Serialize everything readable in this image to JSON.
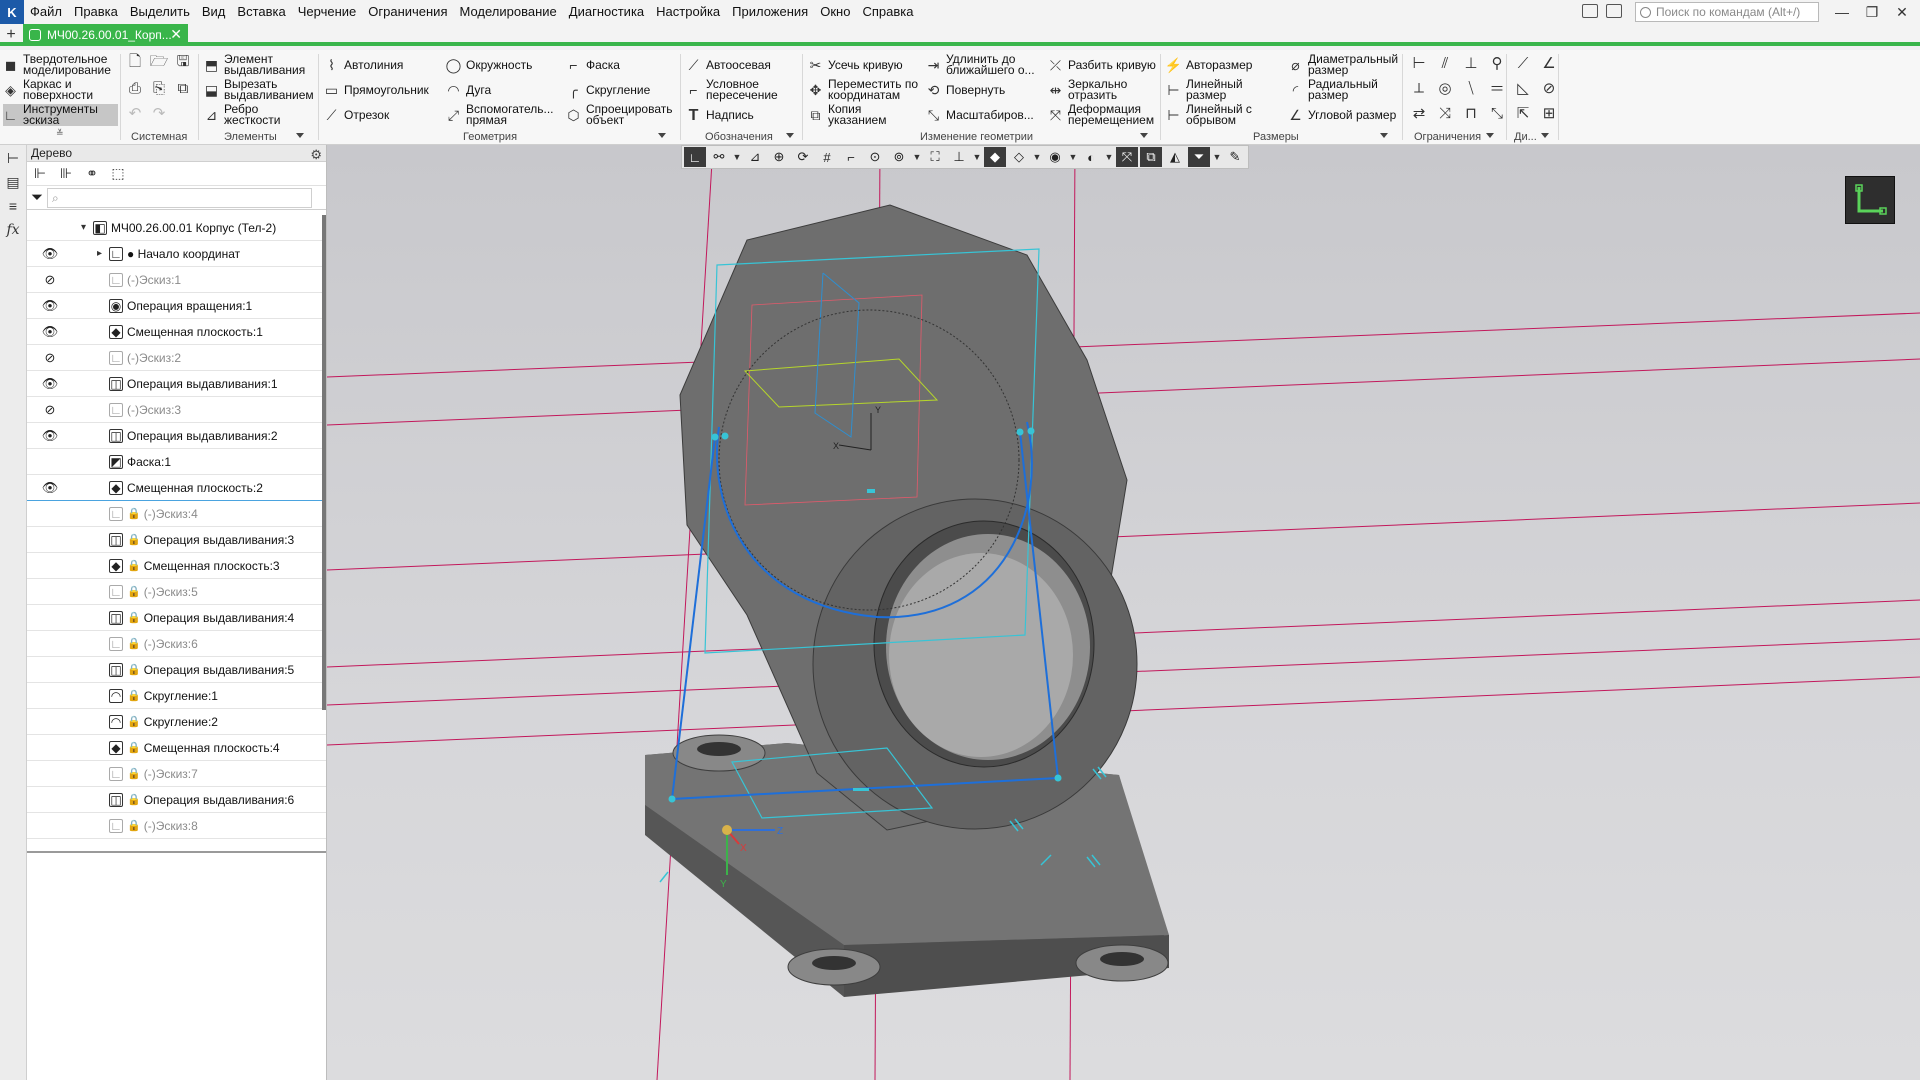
{
  "menubar": {
    "logo": "K",
    "items": [
      "Файл",
      "Правка",
      "Выделить",
      "Вид",
      "Вставка",
      "Черчение",
      "Ограничения",
      "Моделирование",
      "Диагностика",
      "Настройка",
      "Приложения",
      "Окно",
      "Справка"
    ],
    "search_placeholder": "Поиск по командам (Alt+/)"
  },
  "tabs": {
    "plus": "+",
    "doc_label": "МЧ00.26.00.01_Корп...",
    "close": "✕"
  },
  "ribbon": {
    "modes": [
      {
        "label": "Твердотельное\nмоделирование",
        "icon": "solid-icon"
      },
      {
        "label": "Каркас и\nповерхности",
        "icon": "wireframe-icon"
      },
      {
        "label": "Инструменты\nэскиза",
        "icon": "sketch-tools-icon",
        "active": true
      }
    ],
    "groups": {
      "system": "Системная",
      "elements": "Элементы",
      "geometry": "Геометрия",
      "annotations": "Обозначения",
      "modify": "Изменение геометрии",
      "dimensions": "Размеры",
      "constraints": "Ограничения",
      "di": "Ди..."
    },
    "elements": [
      {
        "label": "Элемент\nвыдавливания"
      },
      {
        "label": "Вырезать\nвыдавливанием"
      },
      {
        "label": "Ребро\nжесткости"
      }
    ],
    "geometry": [
      {
        "label": "Автолиния"
      },
      {
        "label": "Прямоугольник"
      },
      {
        "label": "Отрезок"
      },
      {
        "label": "Окружность"
      },
      {
        "label": "Дуга"
      },
      {
        "label": "Вспомогатель...\nпрямая"
      },
      {
        "label": "Фаска"
      },
      {
        "label": "Скругление"
      },
      {
        "label": "Спроецировать\nобъект"
      }
    ],
    "annotations": [
      {
        "label": "Автоосевая"
      },
      {
        "label": "Условное\nпересечение"
      },
      {
        "label": "Надпись"
      }
    ],
    "modify": [
      {
        "label": "Усечь кривую"
      },
      {
        "label": "Переместить по\nкоординатам"
      },
      {
        "label": "Копия\nуказанием"
      },
      {
        "label": "Удлинить до\nближайшего о..."
      },
      {
        "label": "Повернуть"
      },
      {
        "label": "Масштабиров..."
      },
      {
        "label": "Разбить кривую"
      },
      {
        "label": "Зеркально\nотразить"
      },
      {
        "label": "Деформация\nперемещением"
      }
    ],
    "dimensions": [
      {
        "label": "Авторазмер"
      },
      {
        "label": "Линейный\nразмер"
      },
      {
        "label": "Линейный с\nобрывом"
      },
      {
        "label": "Диаметральный\nразмер"
      },
      {
        "label": "Радиальный\nразмер"
      },
      {
        "label": "Угловой размер"
      }
    ]
  },
  "tree": {
    "title": "Дерево",
    "search_placeholder": "⌕",
    "rows": [
      {
        "label": "МЧ00.26.00.01 Корпус (Тел-2)",
        "eye": "",
        "indent": 0,
        "icon": "part-icon",
        "dim": false,
        "lock": false,
        "expander": "▾"
      },
      {
        "label": "● Начало координат",
        "eye": "👁",
        "indent": 1,
        "icon": "origin-icon",
        "dim": false,
        "lock": false,
        "expander": "▸"
      },
      {
        "label": "(-)Эскиз:1",
        "eye": "⊘",
        "indent": 1,
        "icon": "sketch-icon",
        "dim": true,
        "lock": false,
        "expander": ""
      },
      {
        "label": "Операция вращения:1",
        "eye": "👁",
        "indent": 1,
        "icon": "revolve-icon",
        "dim": false,
        "lock": false,
        "expander": ""
      },
      {
        "label": "Смещенная плоскость:1",
        "eye": "👁",
        "indent": 1,
        "icon": "plane-icon",
        "dim": false,
        "lock": false,
        "expander": ""
      },
      {
        "label": "(-)Эскиз:2",
        "eye": "⊘",
        "indent": 1,
        "icon": "sketch-icon",
        "dim": true,
        "lock": false,
        "expander": ""
      },
      {
        "label": "Операция выдавливания:1",
        "eye": "👁",
        "indent": 1,
        "icon": "extrude-icon",
        "dim": false,
        "lock": false,
        "expander": ""
      },
      {
        "label": "(-)Эскиз:3",
        "eye": "⊘",
        "indent": 1,
        "icon": "sketch-icon",
        "dim": true,
        "lock": false,
        "expander": ""
      },
      {
        "label": "Операция выдавливания:2",
        "eye": "👁",
        "indent": 1,
        "icon": "extrude-icon",
        "dim": false,
        "lock": false,
        "expander": ""
      },
      {
        "label": "Фаска:1",
        "eye": "",
        "indent": 1,
        "icon": "chamfer-icon",
        "dim": false,
        "lock": false,
        "expander": ""
      },
      {
        "label": "Смещенная плоскость:2",
        "eye": "👁",
        "indent": 1,
        "icon": "plane-icon",
        "dim": false,
        "lock": false,
        "expander": "",
        "selected": true
      },
      {
        "label": "(-)Эскиз:4",
        "eye": "",
        "indent": 1,
        "icon": "sketch-icon",
        "dim": true,
        "lock": true,
        "expander": ""
      },
      {
        "label": "Операция выдавливания:3",
        "eye": "",
        "indent": 1,
        "icon": "extrude-icon",
        "dim": false,
        "lock": true,
        "expander": ""
      },
      {
        "label": "Смещенная плоскость:3",
        "eye": "",
        "indent": 1,
        "icon": "plane-icon",
        "dim": false,
        "lock": true,
        "expander": ""
      },
      {
        "label": "(-)Эскиз:5",
        "eye": "",
        "indent": 1,
        "icon": "sketch-icon",
        "dim": true,
        "lock": true,
        "expander": ""
      },
      {
        "label": "Операция выдавливания:4",
        "eye": "",
        "indent": 1,
        "icon": "extrude-icon",
        "dim": false,
        "lock": true,
        "expander": ""
      },
      {
        "label": "(-)Эскиз:6",
        "eye": "",
        "indent": 1,
        "icon": "sketch-icon",
        "dim": true,
        "lock": true,
        "expander": ""
      },
      {
        "label": "Операция выдавливания:5",
        "eye": "",
        "indent": 1,
        "icon": "extrude-icon",
        "dim": false,
        "lock": true,
        "expander": ""
      },
      {
        "label": "Скругление:1",
        "eye": "",
        "indent": 1,
        "icon": "fillet-icon",
        "dim": false,
        "lock": true,
        "expander": ""
      },
      {
        "label": "Скругление:2",
        "eye": "",
        "indent": 1,
        "icon": "fillet-icon",
        "dim": false,
        "lock": true,
        "expander": ""
      },
      {
        "label": "Смещенная плоскость:4",
        "eye": "",
        "indent": 1,
        "icon": "plane-icon",
        "dim": false,
        "lock": true,
        "expander": ""
      },
      {
        "label": "(-)Эскиз:7",
        "eye": "",
        "indent": 1,
        "icon": "sketch-icon",
        "dim": true,
        "lock": true,
        "expander": ""
      },
      {
        "label": "Операция выдавливания:6",
        "eye": "",
        "indent": 1,
        "icon": "extrude-icon",
        "dim": false,
        "lock": true,
        "expander": ""
      },
      {
        "label": "(-)Эскиз:8",
        "eye": "",
        "indent": 1,
        "icon": "sketch-icon",
        "dim": true,
        "lock": true,
        "expander": ""
      }
    ]
  },
  "viewport": {
    "axis_labels": {
      "x": "X",
      "y": "Y",
      "z": "Z"
    },
    "sketch_axes": {
      "x": "X",
      "y": "Y"
    },
    "colors": {
      "sketch": "#1e6fd9",
      "plane": "#37c4d6",
      "construction": "#c2185b",
      "background": "#d4d4d7",
      "body": "#6e6e6e"
    }
  }
}
